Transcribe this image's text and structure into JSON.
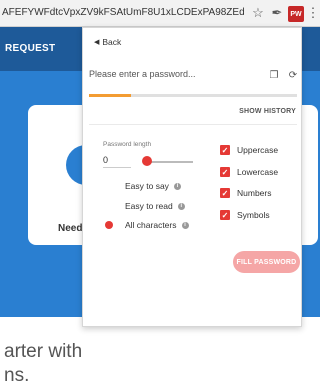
{
  "browser": {
    "url": "AFEFYWFdtcVpxZV9kFSAtUmF8U1xLCDExPA98ZEdVbB4-AS...",
    "star_icon": "star-icon",
    "extension_icon": "pen-icon",
    "active_extension_label": "PW",
    "menu_icon": "kebab-menu-icon"
  },
  "background_page": {
    "header_text": "REQUEST",
    "need_text": "Need",
    "big_text_line1": "arter with",
    "big_text_line2": "ns."
  },
  "popup": {
    "back_label": "Back",
    "password_placeholder": "Please enter a password...",
    "password_value": "",
    "copy_icon": "copy-icon",
    "refresh_icon": "refresh-icon",
    "strength_fraction": 0.2,
    "strength_color": "#f39c32",
    "show_history_label": "SHOW HISTORY",
    "length_label": "Password length",
    "length_value": "0",
    "length_slider_fraction": 0.0,
    "modes": [
      {
        "label": "Easy to say",
        "selected": false
      },
      {
        "label": "Easy to read",
        "selected": false
      },
      {
        "label": "All characters",
        "selected": true
      }
    ],
    "options": [
      {
        "label": "Uppercase",
        "checked": true
      },
      {
        "label": "Lowercase",
        "checked": true
      },
      {
        "label": "Numbers",
        "checked": true
      },
      {
        "label": "Symbols",
        "checked": true
      }
    ],
    "fill_password_label": "FILL PASSWORD",
    "accent_color": "#e53935"
  }
}
